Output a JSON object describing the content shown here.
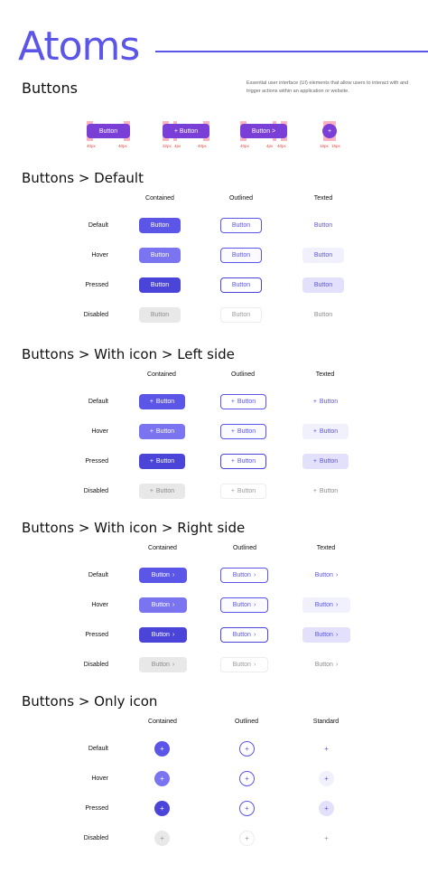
{
  "title": "Atoms",
  "intro": {
    "heading": "Buttons",
    "description": "Essential user interface (UI) elements that allow users to interact with and trigger actions within an application or website."
  },
  "anatomy": {
    "buttons": [
      "Button",
      "+ Button",
      "Button >",
      "+"
    ],
    "labels": [
      "40px",
      "40px",
      "32px",
      "4px",
      "40px",
      "40px",
      "4px",
      "40px",
      "16px",
      "16px"
    ]
  },
  "button_label": "Button",
  "plus": "+",
  "chevron": "›",
  "columns": {
    "standard": [
      "Contained",
      "Outlined",
      "Texted"
    ],
    "icon_only": [
      "Contained",
      "Outlined",
      "Standard"
    ]
  },
  "states": [
    "Default",
    "Hover",
    "Pressed",
    "Disabled"
  ],
  "sections": {
    "default": "Buttons > Default",
    "left_icon": "Buttons > With icon > Left side",
    "right_icon": "Buttons > With icon > Right side",
    "only_icon": "Buttons > Only icon"
  },
  "colors": {
    "primary": "#5b55e8",
    "hover": "#7a74f0",
    "pressed": "#4a44d8",
    "disabled": "#e8e8e8"
  }
}
